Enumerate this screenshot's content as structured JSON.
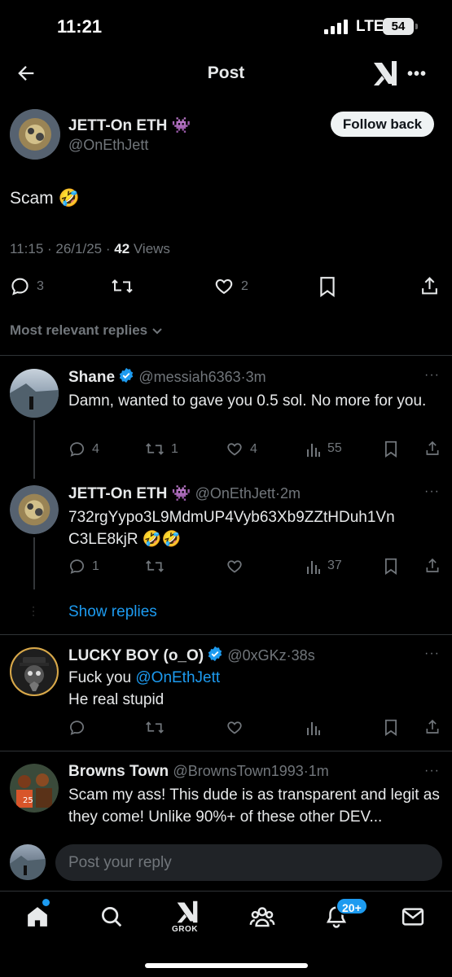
{
  "status_bar": {
    "time": "11:21",
    "network": "LTE",
    "battery": "54"
  },
  "header": {
    "title": "Post",
    "icons": [
      "back-arrow-icon",
      "grok-icon",
      "more-icon"
    ]
  },
  "post": {
    "author_name": "JETT-On ETH",
    "author_emoji": "👾",
    "author_handle": "@OnEthJett",
    "follow_label": "Follow back",
    "text": "Scam 🤣",
    "time": "11:15",
    "date": "26/1/25",
    "views": "42",
    "views_label": " Views",
    "replies": "3",
    "likes": "2"
  },
  "sort": {
    "label": "Most relevant replies"
  },
  "replies": [
    {
      "name": "Shane",
      "verified": true,
      "handle": "@messiah6363",
      "time": "3m",
      "text": "Damn, wanted to gave you 0.5 sol. No more for you.",
      "replies": "4",
      "reposts": "1",
      "likes": "4",
      "views": "55"
    },
    {
      "name": "JETT-On ETH",
      "emoji": "👾",
      "handle": "@OnEthJett",
      "time": "2m",
      "text_line1": "732rgYypo3L9MdmUP4Vyb63Xb9ZZtHDuh1Vn",
      "text_line2": "C3LE8kjR 🤣🤣",
      "replies": "1",
      "views": "37"
    },
    {
      "name": "LUCKY BOY (o_O)",
      "verified": true,
      "handle": "@0xGKz",
      "time": "38s",
      "text_prefix": "Fuck you ",
      "mention": "@OnEthJett",
      "text_line2": "He real stupid"
    },
    {
      "name": "Browns Town",
      "handle": "@BrownsTown1993",
      "time": "1m",
      "text": "Scam my ass! This dude is as transparent and legit as they come! Unlike 90%+ of these other DEV..."
    }
  ],
  "show_replies": "Show replies",
  "composer": {
    "placeholder": "Post your reply"
  },
  "nav": {
    "grok_label": "GROK",
    "notifications_badge": "20+"
  },
  "colors": {
    "accent": "#1d9bf0",
    "background": "#000000",
    "muted": "#71767b",
    "text": "#e7e9ea"
  }
}
